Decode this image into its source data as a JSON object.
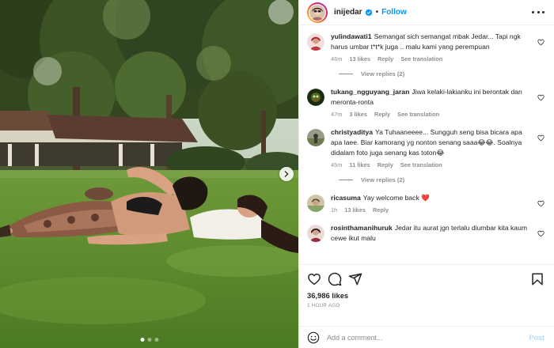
{
  "post": {
    "username": "inijedar",
    "follow_label": "Follow",
    "separator": "•",
    "likes": "36,986 likes",
    "time": "1 HOUR AGO",
    "comment_placeholder": "Add a comment...",
    "post_label": "Post"
  },
  "comments": [
    {
      "user": "yulindawati1",
      "text": "Semangat sich semangat mbak Jedar... Tapi ngk harus umbar t*t*k juga .. malu kami yang perempuan",
      "time": "46m",
      "likes": "13 likes",
      "reply": "Reply",
      "translate": "See translation",
      "view_replies": "View replies (2)"
    },
    {
      "user": "tukang_ngguyang_jaran",
      "text": "Jiwa kelaki-lakianku ini berontak dan meronta-ronta",
      "time": "47m",
      "likes": "3 likes",
      "reply": "Reply",
      "translate": "See translation"
    },
    {
      "user": "christyaditya",
      "text": "Ya Tuhaaneeee... Sungguh seng bisa bicara apa apa laee. Biar kamorang yg nonton senang saaa😂😂. Soalnya didalam foto juga senang kas toton😂",
      "time": "45m",
      "likes": "11 likes",
      "reply": "Reply",
      "translate": "See translation",
      "view_replies": "View replies (2)"
    },
    {
      "user": "ricasuma",
      "text": "Yay welcome back ❤️",
      "time": "1h",
      "likes": "13 likes",
      "reply": "Reply"
    },
    {
      "user": "rosinthamanihuruk",
      "text": "Jedar itu aurat jgn terlalu diumbar kita kaum cewe ikut malu"
    }
  ],
  "icons": {
    "verified": "verified-badge-icon",
    "more": "more-options-icon",
    "like": "heart-icon",
    "comment": "comment-icon",
    "share": "share-icon",
    "save": "bookmark-icon",
    "emoji": "emoji-icon",
    "next": "chevron-right-icon"
  },
  "colors": {
    "link_blue": "#0095f6",
    "post_disabled": "#b2dffc",
    "muted": "#8e8e8e",
    "text": "#262626"
  }
}
